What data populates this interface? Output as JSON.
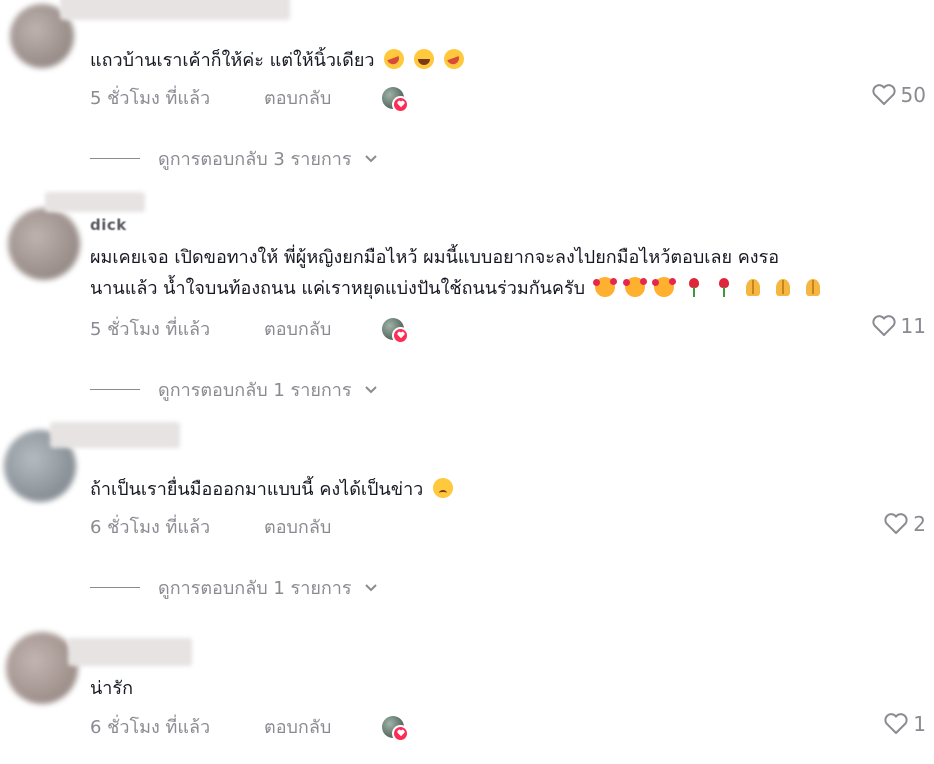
{
  "comments": [
    {
      "username": "",
      "text": "แถวบ้านเราเค้าก็ให้ค่ะ แต่ให้นิ้วเดียว",
      "emojis": [
        "rofl-icon",
        "joy-icon",
        "rofl-icon"
      ],
      "time": "5 ชั่วโมง ที่แล้ว",
      "reply": "ตอบกลับ",
      "creator_liked": true,
      "likes": "50",
      "view_replies": "ดูการตอบกลับ 3 รายการ"
    },
    {
      "username": "dick",
      "text_line1": "ผมเคยเจอ เปิดขอทางให้ พี่ผู้หญิงยกมือไหว้ ผมนี้แบบอยากจะลงไปยกมือไหว้ตอบเลย คงรอ",
      "text_line2": "นานแล้ว น้ำใจบนท้องถนน แค่เราหยุดแบ่งปันใช้ถนนร่วมกันครับ",
      "emojis": [
        "smiling-face-with-hearts-icon",
        "smiling-face-with-hearts-icon",
        "smiling-face-with-hearts-icon",
        "rose-icon",
        "rose-icon",
        "folded-hands-icon",
        "folded-hands-icon",
        "folded-hands-icon"
      ],
      "time": "5 ชั่วโมง ที่แล้ว",
      "reply": "ตอบกลับ",
      "creator_liked": true,
      "likes": "11",
      "view_replies": "ดูการตอบกลับ 1 รายการ"
    },
    {
      "username": "",
      "text": "ถ้าเป็นเรายื่นมือออกมาแบบนี้ คงได้เป็นข่าว",
      "emojis": [
        "disappointed-face-icon"
      ],
      "time": "6 ชั่วโมง ที่แล้ว",
      "reply": "ตอบกลับ",
      "creator_liked": false,
      "likes": "2",
      "view_replies": "ดูการตอบกลับ 1 รายการ"
    },
    {
      "username": "",
      "text": "น่ารัก",
      "emojis": [],
      "time": "6 ชั่วโมง ที่แล้ว",
      "reply": "ตอบกลับ",
      "creator_liked": true,
      "likes": "1"
    }
  ],
  "colors": {
    "text": "#161823",
    "muted": "#8a8b91",
    "badge": "#fe2c55"
  }
}
